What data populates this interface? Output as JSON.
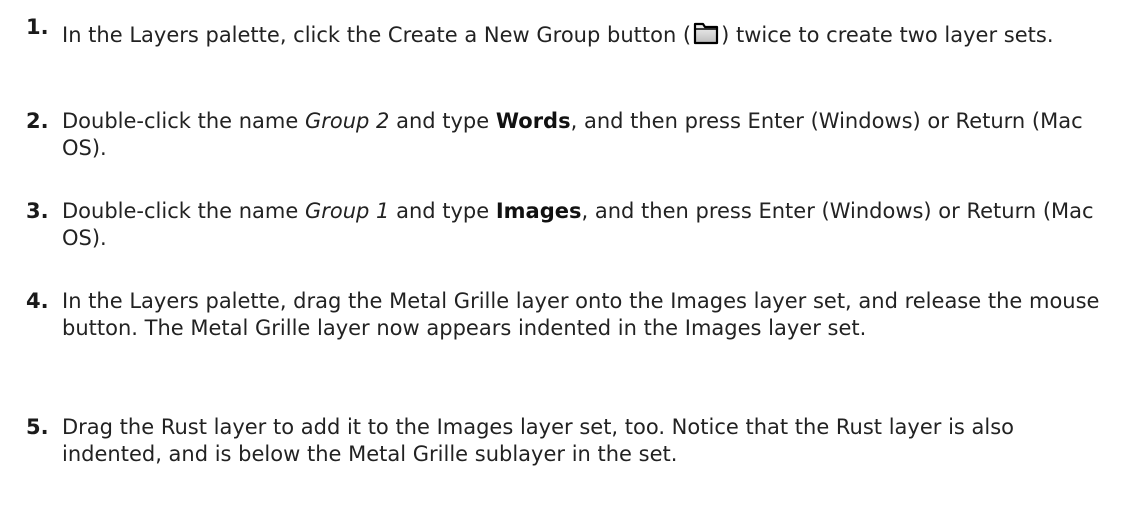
{
  "steps": [
    {
      "number": "1.",
      "parts": {
        "a": "In the Layers palette, click the Create a New Group button (",
        "icon": "folder-icon",
        "b": ") twice to create two layer sets."
      }
    },
    {
      "number": "2.",
      "parts": {
        "a": "Double-click the name ",
        "italic": "Group 2",
        "b": " and type ",
        "bold": "Words",
        "c": ", and then press Enter (Windows) or Return (Mac OS)."
      }
    },
    {
      "number": "3.",
      "parts": {
        "a": "Double-click the name ",
        "italic": "Group 1",
        "b": " and type ",
        "bold": "Images",
        "c": ", and then press Enter (Windows) or Return (Mac OS)."
      }
    },
    {
      "number": "4.",
      "text": "In the Layers palette, drag the Metal Grille layer onto the Images layer set, and release the mouse button. The Metal Grille layer now appears indented in the Images layer set."
    },
    {
      "number": "5.",
      "text": "Drag the Rust layer to add it to the Images layer set, too. Notice that the Rust layer is also indented, and is below the Metal Grille sublayer in the set."
    }
  ]
}
